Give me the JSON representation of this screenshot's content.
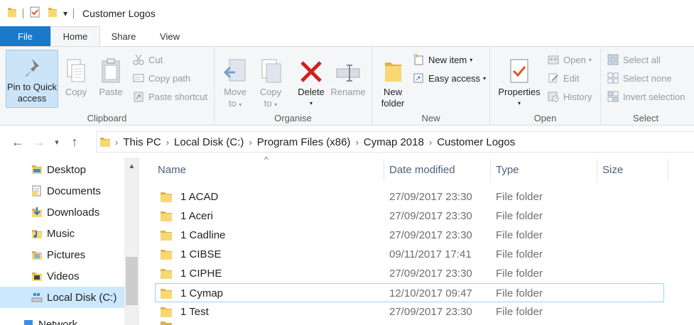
{
  "titlebar": {
    "title": "Customer Logos",
    "qat_dropdown": "▾"
  },
  "tabs": [
    "File",
    "Home",
    "Share",
    "View"
  ],
  "ribbon": {
    "clipboard": {
      "label": "Clipboard",
      "pin_line1": "Pin to Quick",
      "pin_line2": "access",
      "copy": "Copy",
      "paste": "Paste",
      "cut": "Cut",
      "copy_path": "Copy path",
      "paste_shortcut": "Paste shortcut"
    },
    "organise": {
      "label": "Organise",
      "move_to_1": "Move",
      "move_to_2": "to",
      "copy_to_1": "Copy",
      "copy_to_2": "to",
      "delete": "Delete",
      "rename": "Rename"
    },
    "new": {
      "label": "New",
      "new_folder_1": "New",
      "new_folder_2": "folder",
      "new_item": "New item",
      "easy_access": "Easy access"
    },
    "open": {
      "label": "Open",
      "properties": "Properties",
      "open": "Open",
      "edit": "Edit",
      "history": "History"
    },
    "select": {
      "label": "Select",
      "select_all": "Select all",
      "select_none": "Select none",
      "invert_selection": "Invert selection"
    }
  },
  "address": {
    "crumbs": [
      "This PC",
      "Local Disk (C:)",
      "Program Files (x86)",
      "Cymap 2018",
      "Customer Logos"
    ],
    "separator": "›"
  },
  "navpane": {
    "items": [
      {
        "label": "Desktop",
        "icon": "desktop-folder-icon"
      },
      {
        "label": "Documents",
        "icon": "documents-folder-icon"
      },
      {
        "label": "Downloads",
        "icon": "downloads-folder-icon"
      },
      {
        "label": "Music",
        "icon": "music-folder-icon"
      },
      {
        "label": "Pictures",
        "icon": "pictures-folder-icon"
      },
      {
        "label": "Videos",
        "icon": "videos-folder-icon"
      },
      {
        "label": "Local Disk (C:)",
        "icon": "local-disk-icon"
      },
      {
        "label": "Network",
        "icon": "network-icon"
      }
    ],
    "selected": "Local Disk (C:)"
  },
  "filelist": {
    "columns": [
      "Name",
      "Date modified",
      "Type",
      "Size"
    ],
    "sort_indicator": "^",
    "rows": [
      {
        "name": "1 ACAD",
        "date": "27/09/2017 23:30",
        "type": "File folder"
      },
      {
        "name": "1 Aceri",
        "date": "27/09/2017 23:30",
        "type": "File folder"
      },
      {
        "name": "1 Cadline",
        "date": "27/09/2017 23:30",
        "type": "File folder"
      },
      {
        "name": "1 CIBSE",
        "date": "09/11/2017 17:41",
        "type": "File folder"
      },
      {
        "name": "1 CIPHE",
        "date": "27/09/2017 23:30",
        "type": "File folder"
      },
      {
        "name": "1 Cymap",
        "date": "12/10/2017 09:47",
        "type": "File folder"
      },
      {
        "name": "1 Test",
        "date": "27/09/2017 23:30",
        "type": "File folder"
      }
    ],
    "focused_row": "1 Cymap"
  },
  "colors": {
    "file_tab": "#1979ca",
    "folder_yellow": "#f8d775",
    "delete_red": "#d31f1f",
    "selection": "#cce8ff"
  }
}
